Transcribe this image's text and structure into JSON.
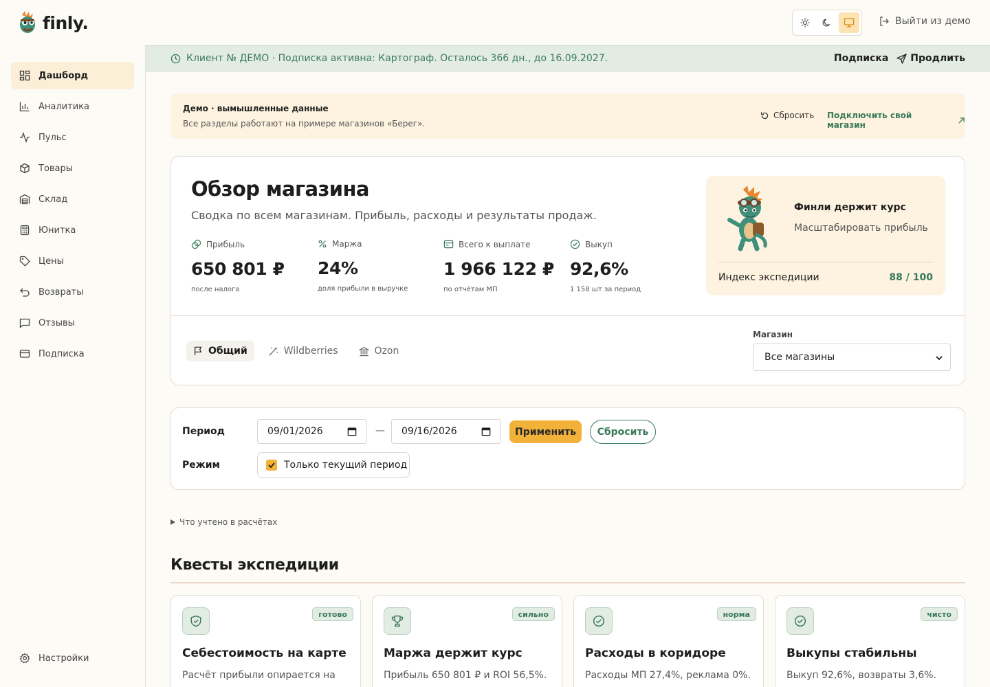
{
  "header": {
    "logo_text": "finly.",
    "exit_demo_label": "Выйти из демо",
    "theme_options": [
      "light-icon",
      "moon-icon",
      "monitor-icon"
    ],
    "theme_active": "monitor-icon"
  },
  "sidebar": {
    "items": [
      {
        "label": "Дашборд",
        "icon": "dashboard-icon",
        "active": true
      },
      {
        "label": "Аналитика",
        "icon": "bar-chart-icon"
      },
      {
        "label": "Пульс",
        "icon": "pulse-icon"
      },
      {
        "label": "Товары",
        "icon": "box-icon"
      },
      {
        "label": "Склад",
        "icon": "warehouse-icon"
      },
      {
        "label": "Юнитка",
        "icon": "calculator-icon"
      },
      {
        "label": "Цены",
        "icon": "tag-icon"
      },
      {
        "label": "Возвраты",
        "icon": "return-icon"
      },
      {
        "label": "Отзывы",
        "icon": "message-icon"
      },
      {
        "label": "Подписка",
        "icon": "card-icon"
      }
    ],
    "settings_label": "Настройки"
  },
  "subscription_bar": {
    "text": "Клиент № ДЕМО · Подписка активна: Картограф. Осталось 366 дн., до 16.09.2027.",
    "subscription_link": "Подписка",
    "extend_link": "Продлить"
  },
  "demo_banner": {
    "title": "Демо · вымышленные данные",
    "subtitle": "Все разделы работают на примере магазинов «Берег».",
    "reset_label": "Сбросить",
    "connect_label": "Подключить свой магазин"
  },
  "overview": {
    "title": "Обзор магазина",
    "subtitle": "Сводка по всем магазинам. Прибыль, расходы и результаты продаж.",
    "metrics": [
      {
        "label": "Прибыль",
        "value": "650 801 ₽",
        "note": "после налога",
        "icon": "coins-icon"
      },
      {
        "label": "Маржа",
        "value": "24%",
        "note": "доля прибыли в выручке",
        "icon": "percent-icon"
      },
      {
        "label": "Всего к выплате",
        "value": "1 966 122 ₽",
        "note": "по отчётам МП",
        "icon": "wallet-icon"
      },
      {
        "label": "Выкуп",
        "value": "92,6%",
        "note": "1 158 шт за период",
        "icon": "check-circle-icon"
      }
    ],
    "mascot_card": {
      "title": "Финли держит курс",
      "subtitle": "Масштабировать прибыль",
      "index_label": "Индекс экспедиции",
      "index_value": "88 / 100"
    },
    "tabs": [
      {
        "label": "Общий",
        "icon": "flag-icon",
        "active": true
      },
      {
        "label": "Wildberries",
        "icon": "wand-icon"
      },
      {
        "label": "Ozon",
        "icon": "bank-icon"
      }
    ],
    "store_label": "Магазин",
    "store_value": "Все магазины"
  },
  "filter": {
    "period_label": "Период",
    "date_from": "09/01/2026",
    "date_to": "09/16/2026",
    "dash": "—",
    "apply_label": "Применить",
    "reset_label": "Сбросить",
    "mode_label": "Режим",
    "mode_option": "Только текущий период",
    "mode_checked": true
  },
  "counted_label": "Что учтено в расчётах",
  "quests": {
    "title": "Квесты экспедиции",
    "items": [
      {
        "badge": "готово",
        "title": "Себестоимость на карте",
        "text": "Расчёт прибыли опирается на",
        "icon": "shield-check-icon"
      },
      {
        "badge": "сильно",
        "title": "Маржа держит курс",
        "text": "Прибыль 650 801 ₽ и ROI 56,5%.",
        "icon": "trophy-icon"
      },
      {
        "badge": "норма",
        "title": "Расходы в коридоре",
        "text": "Расходы МП 27,4%, реклама 0%.",
        "icon": "check-circle-icon"
      },
      {
        "badge": "чисто",
        "title": "Выкупы стабильны",
        "text": "Выкуп 92,6%, возвраты 3,6%.",
        "icon": "check-circle-icon"
      }
    ]
  },
  "colors": {
    "accent_green": "#3a7a5a",
    "accent_orange": "#f2b138",
    "cream": "#fdf3e0",
    "page_bg": "#fdfbf6"
  }
}
